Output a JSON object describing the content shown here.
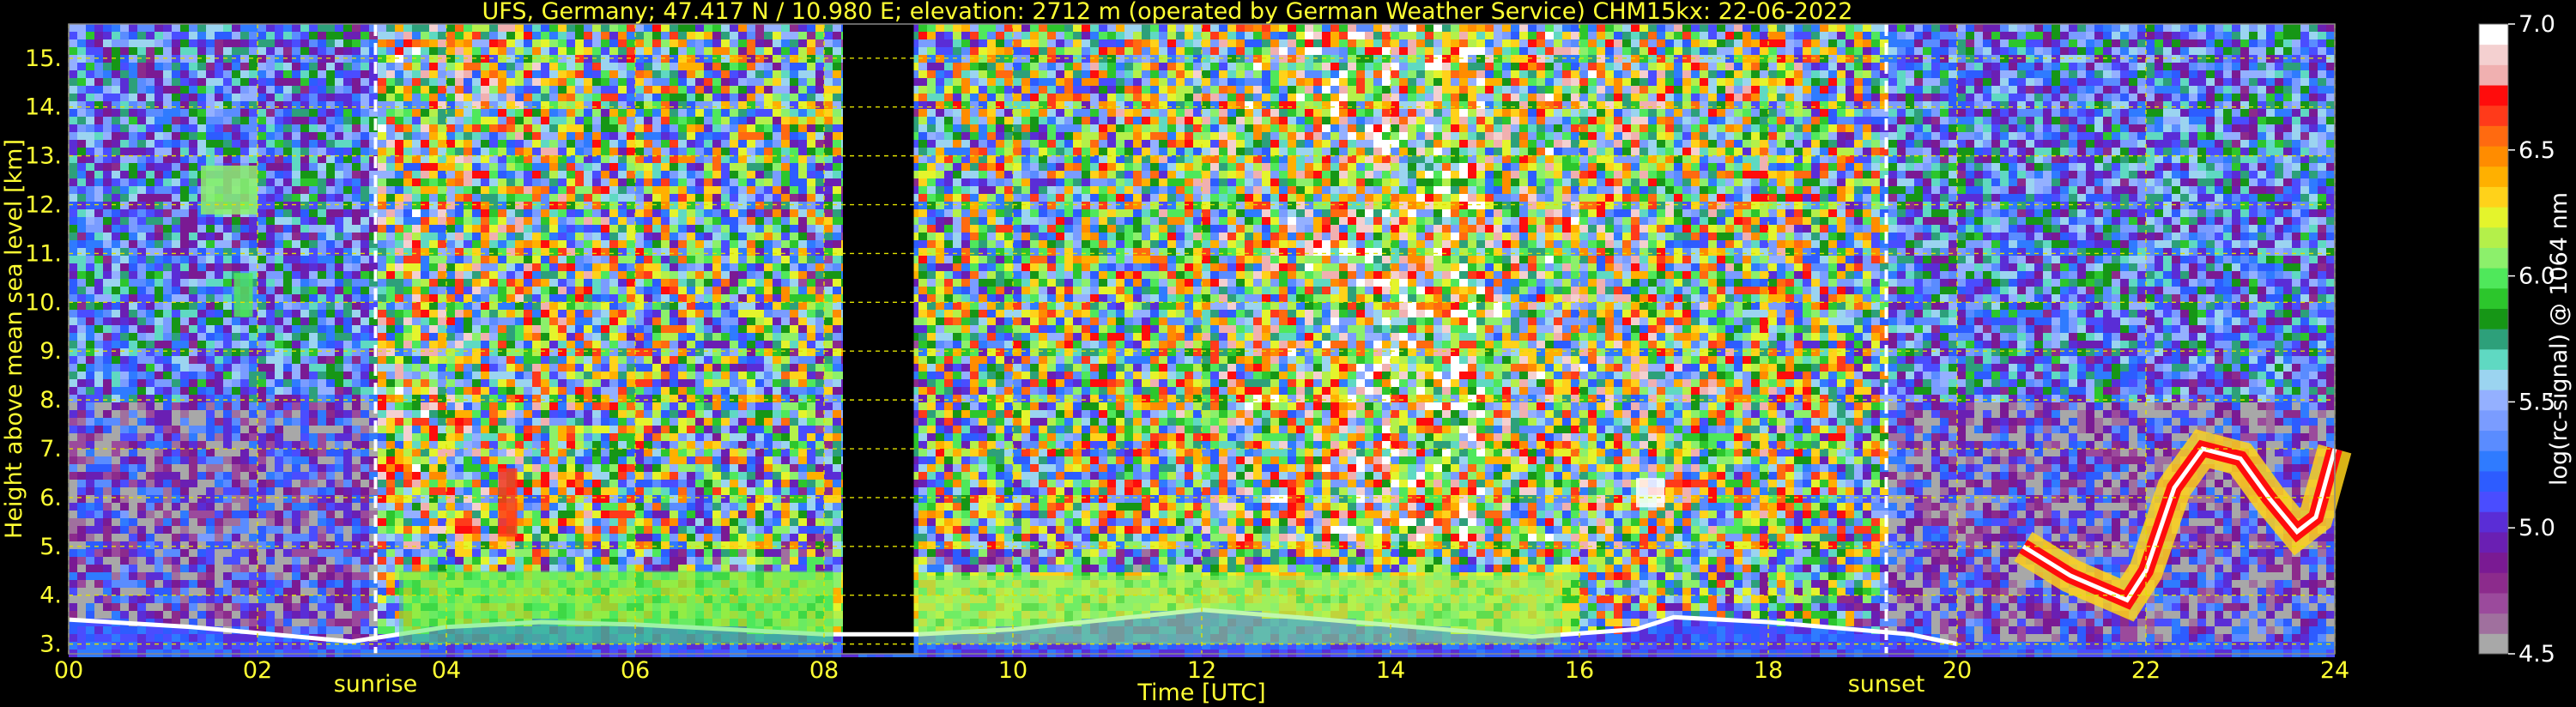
{
  "chart_data": {
    "type": "heatmap",
    "title": "UFS, Germany; 47.417 N / 10.980 E; elevation: 2712 m  (operated by German Weather Service)    CHM15kx: 22-06-2022",
    "xlabel": "Time [UTC]",
    "ylabel": "Height above mean sea level [km]",
    "xlim": [
      0,
      24
    ],
    "ylim": [
      2.8,
      15.7
    ],
    "x_ticks": [
      "00",
      "02",
      "04",
      "06",
      "08",
      "10",
      "12",
      "14",
      "16",
      "18",
      "20",
      "22",
      "24"
    ],
    "y_ticks": [
      "3.",
      "4.",
      "5.",
      "6.",
      "7.",
      "8.",
      "9.",
      "10.",
      "11.",
      "12.",
      "13.",
      "14.",
      "15."
    ],
    "grid": true,
    "annotations": [
      {
        "text": "sunrise",
        "x": 3.25
      },
      {
        "text": "sunset",
        "x": 19.25
      }
    ],
    "no_data_intervals": [
      [
        8.2,
        8.95
      ]
    ],
    "colorbar": {
      "label": "log(rc-signal) @ 1064 nm",
      "range": [
        4.5,
        7.0
      ],
      "ticks": [
        "4.5",
        "5.0",
        "5.5",
        "6.0",
        "6.5",
        "7.0"
      ],
      "colors": [
        "#a8a8a8",
        "#a0709e",
        "#9b4a9c",
        "#8c2b8c",
        "#7a1a93",
        "#6a1fb3",
        "#5a2dd6",
        "#4a4dff",
        "#2d5cff",
        "#2f7bff",
        "#5a8cff",
        "#7a9cff",
        "#94b0ff",
        "#9bd4f0",
        "#5fd9c2",
        "#2da07a",
        "#169616",
        "#2cc62c",
        "#4fe85b",
        "#8cf06b",
        "#b4f04a",
        "#e4f42c",
        "#ffd21a",
        "#ffb000",
        "#ff8c00",
        "#ff6a10",
        "#ff3a1a",
        "#ff0c0c",
        "#f0b0b0",
        "#f4d0d0",
        "#ffffff"
      ]
    },
    "features": [
      {
        "kind": "boundary_layer",
        "points": [
          [
            0,
            3.5
          ],
          [
            1.3,
            3.35
          ],
          [
            3,
            3.05
          ],
          [
            4,
            3.35
          ],
          [
            5,
            3.45
          ],
          [
            6,
            3.4
          ],
          [
            7,
            3.3
          ],
          [
            8,
            3.2
          ],
          [
            9,
            3.2
          ],
          [
            10,
            3.3
          ],
          [
            12,
            3.7
          ],
          [
            13,
            3.55
          ],
          [
            15.5,
            3.15
          ],
          [
            16.6,
            3.3
          ],
          [
            17,
            3.55
          ],
          [
            18,
            3.45
          ],
          [
            19.5,
            3.2
          ],
          [
            20,
            3.0
          ]
        ]
      },
      {
        "kind": "aerosol_layer",
        "x": [
          3.5,
          8.1
        ],
        "y": [
          3.0,
          4.5
        ],
        "level": 6.0
      },
      {
        "kind": "aerosol_layer",
        "x": [
          9.0,
          15.8
        ],
        "y": [
          3.0,
          4.4
        ],
        "level": 6.1
      },
      {
        "kind": "cloud_layer",
        "points": [
          [
            20.7,
            5.0
          ],
          [
            21.2,
            4.4
          ],
          [
            21.8,
            3.9
          ],
          [
            22,
            4.5
          ],
          [
            22.3,
            6.2
          ],
          [
            22.6,
            7.0
          ],
          [
            23,
            6.8
          ],
          [
            23.3,
            6.0
          ],
          [
            23.6,
            5.3
          ],
          [
            23.8,
            5.6
          ],
          [
            24,
            7.0
          ]
        ],
        "level": 6.7
      },
      {
        "kind": "cirrus",
        "x": [
          1.4,
          2.0
        ],
        "y": [
          11.8,
          12.8
        ],
        "level": 6.1
      },
      {
        "kind": "cirrus",
        "x": [
          1.75,
          1.95
        ],
        "y": [
          9.7,
          10.6
        ],
        "level": 6.0
      },
      {
        "kind": "cirrus",
        "x": [
          4.55,
          4.75
        ],
        "y": [
          5.2,
          6.6
        ],
        "level": 6.6
      },
      {
        "kind": "cloud",
        "x": [
          16.6,
          16.9
        ],
        "y": [
          5.8,
          6.4
        ],
        "level": 7.0
      }
    ]
  }
}
